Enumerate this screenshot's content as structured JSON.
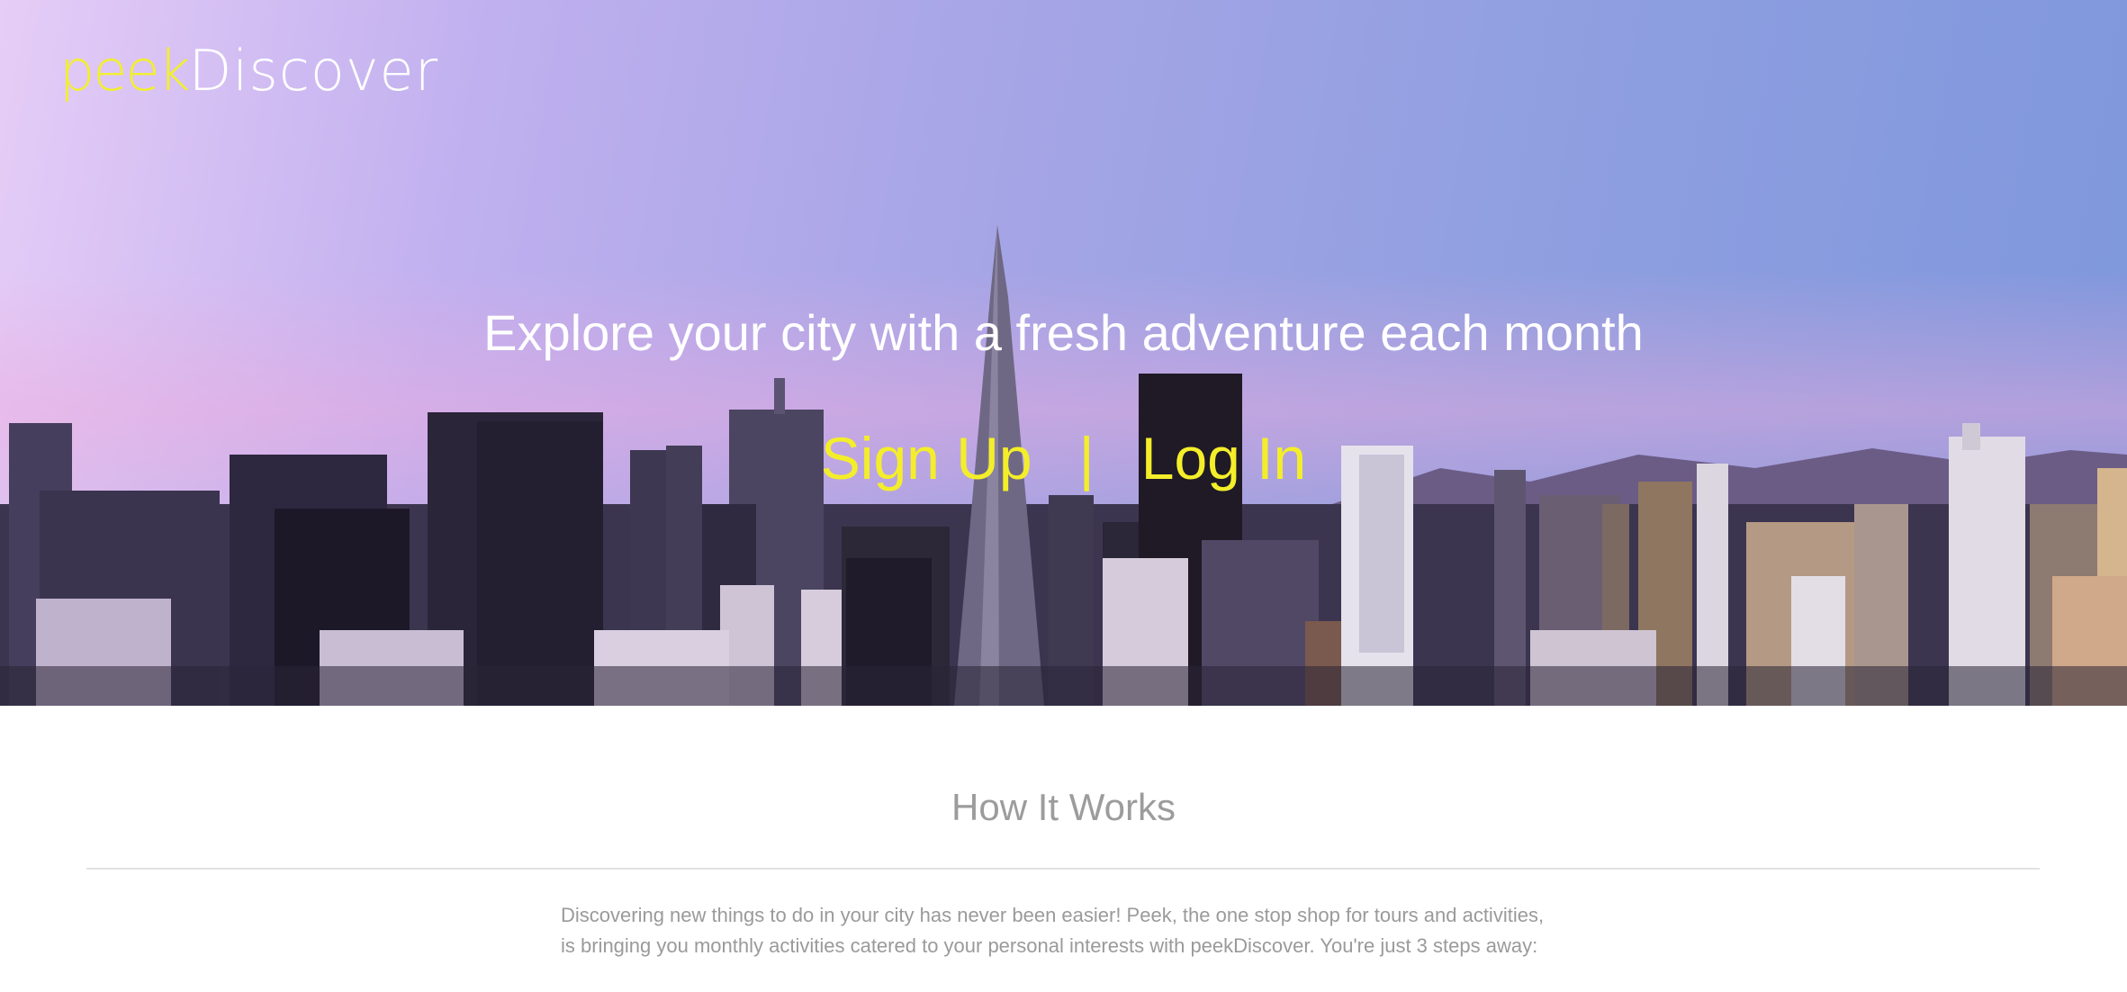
{
  "brand": {
    "logo_part1": "peek",
    "logo_part2": "Discover",
    "accent_color": "#f4ee2a"
  },
  "hero": {
    "tagline": "Explore your city with a fresh adventure each month",
    "signup_label": "Sign Up",
    "separator": "|",
    "login_label": "Log In",
    "background": "city-skyline-photo"
  },
  "how_it_works": {
    "title": "How It Works",
    "intro_line1": "Discovering new things to do in your city has never been easier! Peek, the one stop shop for tours and activities,",
    "intro_line2": "is bringing you monthly activities catered to your personal interests with peekDiscover. You're just 3 steps away:"
  }
}
